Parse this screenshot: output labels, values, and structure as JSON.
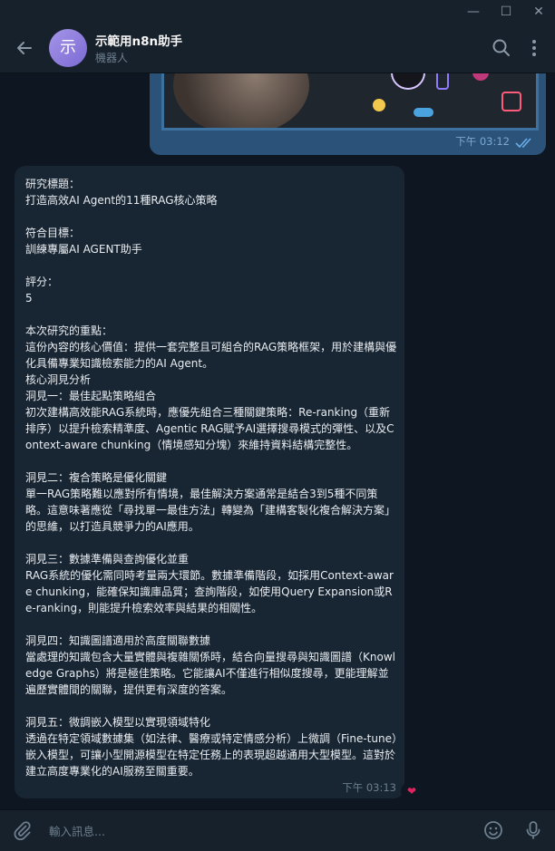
{
  "window": {
    "minimize_glyph": "—",
    "maximize_glyph": "☐",
    "close_glyph": "✕"
  },
  "header": {
    "avatar_letter": "示",
    "title": "示範用n8n助手",
    "subtitle": "機器人",
    "icons": [
      "back-arrow-icon",
      "search-icon",
      "more-vertical-icon"
    ]
  },
  "outgoing_message": {
    "time": "下午 03:12",
    "status": "read"
  },
  "incoming_message": {
    "text": "研究標題：\n打造高效AI Agent的11種RAG核心策略\n\n符合目標：\n訓練專屬AI AGENT助手\n\n評分：\n5\n\n本次研究的重點：\n這份內容的核心價值：提供一套完整且可組合的RAG策略框架，用於建構與優化具備專業知識檢索能力的AI Agent。\n核心洞見分析\n洞見一：最佳起點策略組合\n初次建構高效能RAG系統時，應優先組合三種關鍵策略：Re-ranking（重新排序）以提升檢索精準度、Agentic RAG賦予AI選擇搜尋模式的彈性、以及Context-aware chunking（情境感知分塊）來維持資料結構完整性。\n\n洞見二：複合策略是優化關鍵\n單一RAG策略難以應對所有情境，最佳解決方案通常是結合3到5種不同策略。這意味著應從「尋找單一最佳方法」轉變為「建構客製化複合解決方案」的思維，以打造具競爭力的AI應用。\n\n洞見三：數據準備與查詢優化並重\nRAG系統的優化需同時考量兩大環節。數據準備階段，如採用Context-aware chunking，能確保知識庫品質；查詢階段，如使用Query Expansion或Re-ranking，則能提升檢索效率與結果的相關性。\n\n洞見四：知識圖譜適用於高度關聯數據\n當處理的知識包含大量實體與複雜關係時，結合向量搜尋與知識圖譜（Knowledge Graphs）將是極佳策略。它能讓AI不僅進行相似度搜尋，更能理解並遍歷實體間的關聯，提供更有深度的答案。\n\n洞見五：微調嵌入模型以實現領域特化\n透過在特定領域數據集（如法律、醫療或特定情感分析）上微調（Fine-tune）嵌入模型，可讓小型開源模型在特定任務上的表現超越通用大型模型。這對於建立高度專業化的AI服務至關重要。",
    "time": "下午 03:13",
    "reaction": "❤"
  },
  "input": {
    "placeholder": "輸入訊息...",
    "value": ""
  },
  "colors": {
    "background": "#0e1621",
    "panel": "#17212b",
    "outgoing_bubble": "#2b5278",
    "incoming_bubble": "#182533",
    "accent": "#5eb5f7"
  }
}
